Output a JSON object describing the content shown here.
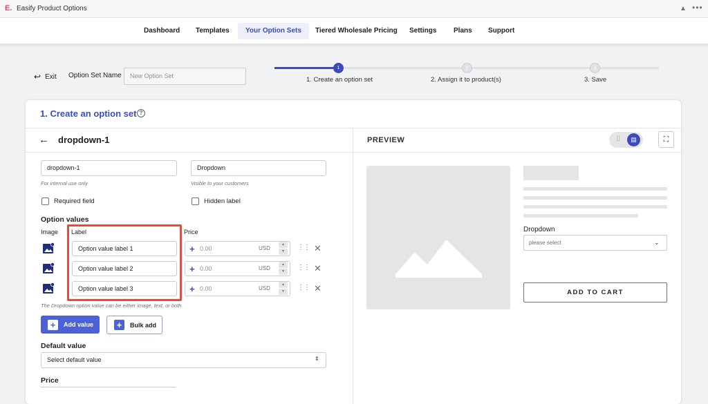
{
  "app": {
    "title": "Easify Product Options",
    "logo": "E."
  },
  "nav": {
    "items": [
      {
        "label": "Dashboard",
        "active": false
      },
      {
        "label": "Templates",
        "active": false
      },
      {
        "label": "Your Option Sets",
        "active": true
      },
      {
        "label": "Tiered Wholesale Pricing",
        "active": false
      },
      {
        "label": "Settings",
        "active": false
      },
      {
        "label": "Plans",
        "active": false
      },
      {
        "label": "Support",
        "active": false
      }
    ]
  },
  "header": {
    "exit_label": "Exit",
    "option_set_name_label": "Option Set Name",
    "option_set_name_placeholder": "New Option Set"
  },
  "steps": [
    {
      "number": "1",
      "label": "1. Create an option set",
      "active": true
    },
    {
      "number": "2",
      "label": "2. Assign it to product(s)",
      "active": false
    },
    {
      "number": "3",
      "label": "3. Save",
      "active": false
    }
  ],
  "card": {
    "title": "1. Create an option set",
    "help_icon": "?"
  },
  "editor": {
    "option_name": "dropdown-1",
    "internal_name_value": "dropdown-1",
    "internal_name_hint": "For internal use only",
    "display_name_value": "Dropdown",
    "display_name_hint": "Visible to your customers",
    "required_label": "Required field",
    "hidden_label": "Hidden label",
    "option_values_title": "Option values",
    "col_image": "Image",
    "col_label": "Label",
    "col_price": "Price",
    "values": [
      {
        "label": "Option value label 1",
        "price_placeholder": "0.00",
        "currency": "USD"
      },
      {
        "label": "Option value label 2",
        "price_placeholder": "0.00",
        "currency": "USD"
      },
      {
        "label": "Option value label 3",
        "price_placeholder": "0.00",
        "currency": "USD"
      }
    ],
    "values_hint": "The Dropdown option value can be either image, text, or both",
    "add_value_label": "Add value",
    "bulk_add_label": "Bulk add",
    "default_value_title": "Default value",
    "default_value_select": "Select default value",
    "price_title": "Price"
  },
  "preview": {
    "title": "PREVIEW",
    "dropdown_label": "Dropdown",
    "dropdown_placeholder": "please select",
    "add_to_cart": "ADD TO CART"
  },
  "colors": {
    "accent": "#3b4cb8",
    "button": "#4d61d6",
    "highlight": "#e24c3f"
  }
}
